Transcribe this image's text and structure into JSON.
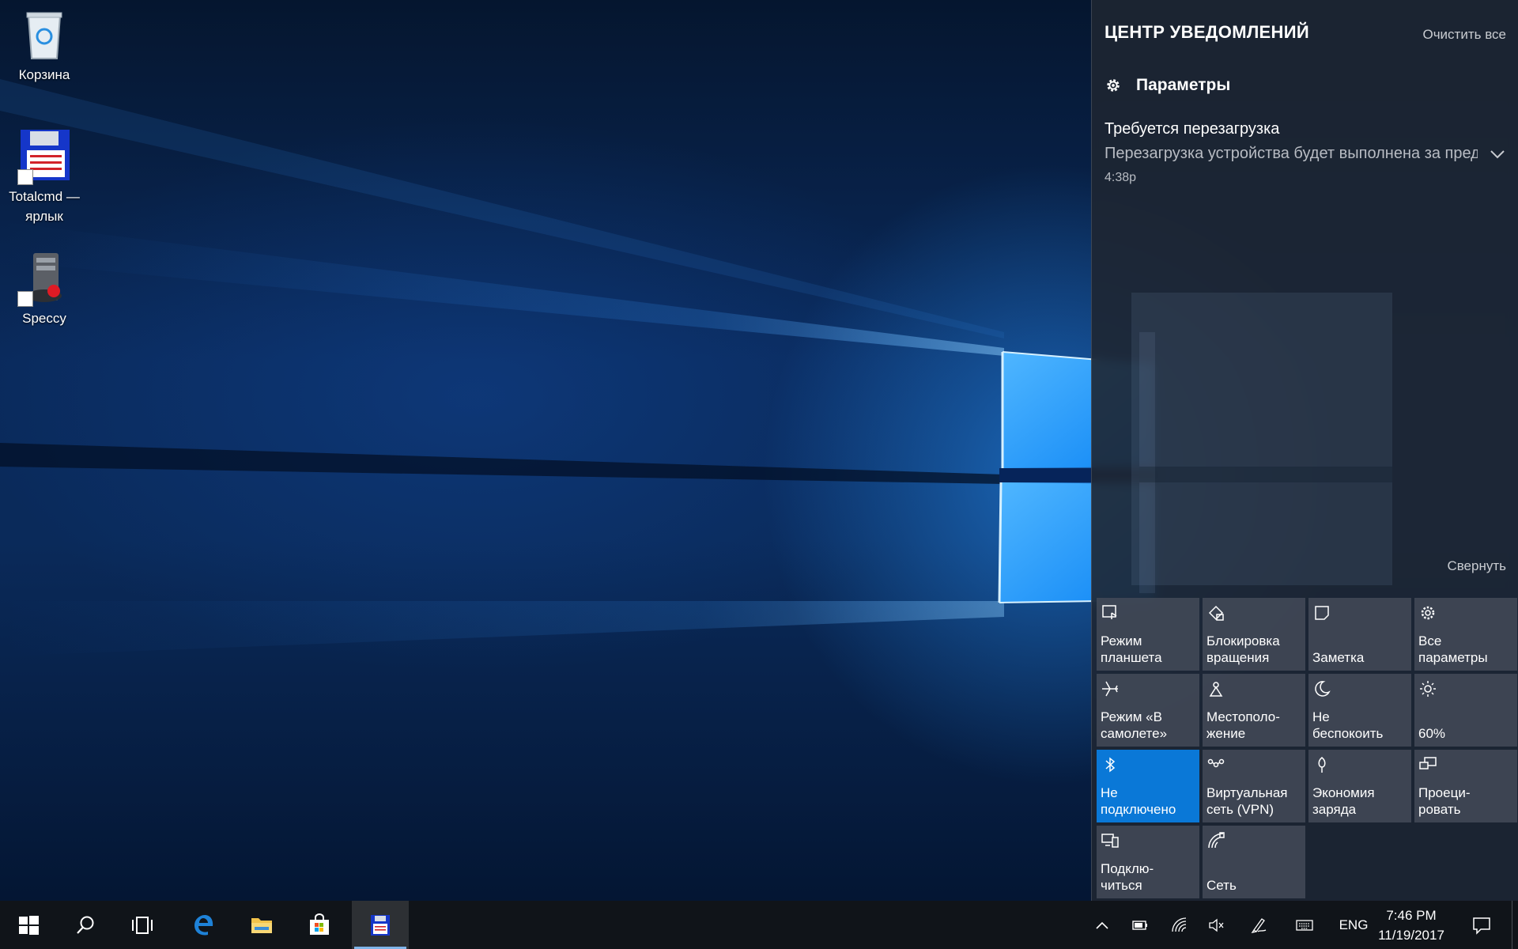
{
  "desktop": {
    "icons": [
      {
        "label": "Корзина",
        "icon": "recycle-bin-icon"
      },
      {
        "label": "Totalcmd — ярлык",
        "icon": "floppy-disk-icon"
      },
      {
        "label": "Speccy",
        "icon": "speccy-icon"
      }
    ]
  },
  "action_center": {
    "title": "ЦЕНТР УВЕДОМЛЕНИЙ",
    "clear_all": "Очистить все",
    "app_group": {
      "label": "Параметры",
      "icon": "gear-icon"
    },
    "notification": {
      "title": "Требуется перезагрузка",
      "body": "Перезагрузка устройства будет выполнена за пределами периода активности.",
      "time": "4:38р"
    },
    "collapse": "Свернуть",
    "quick_actions": [
      {
        "label": "Режим\nпланшета",
        "icon": "tablet-mode-icon",
        "active": false
      },
      {
        "label": "Блокировка\nвращения",
        "icon": "rotation-lock-icon",
        "active": false
      },
      {
        "label": "Заметка",
        "icon": "note-icon",
        "active": false
      },
      {
        "label": "Все\nпараметры",
        "icon": "settings-icon",
        "active": false
      },
      {
        "label": "Режим «В\nсамолете»",
        "icon": "airplane-icon",
        "active": false
      },
      {
        "label": "Местополо-\nжение",
        "icon": "location-icon",
        "active": false
      },
      {
        "label": "Не\nбеспокоить",
        "icon": "moon-icon",
        "active": false
      },
      {
        "label": "60%",
        "icon": "brightness-icon",
        "active": false
      },
      {
        "label": "Не\nподключено",
        "icon": "bluetooth-icon",
        "active": true
      },
      {
        "label": "Виртуальная\nсеть (VPN)",
        "icon": "vpn-icon",
        "active": false
      },
      {
        "label": "Экономия\nзаряда",
        "icon": "battery-saver-icon",
        "active": false
      },
      {
        "label": "Проеци-\nровать",
        "icon": "project-icon",
        "active": false
      },
      {
        "label": "Подклю-\nчиться",
        "icon": "connect-icon",
        "active": false
      },
      {
        "label": "Сеть",
        "icon": "network-icon",
        "active": false
      }
    ]
  },
  "taskbar": {
    "pinned": [
      {
        "name": "start",
        "icon": "windows-logo-icon"
      },
      {
        "name": "search",
        "icon": "search-icon"
      },
      {
        "name": "task-view",
        "icon": "task-view-icon"
      },
      {
        "name": "edge",
        "icon": "edge-icon"
      },
      {
        "name": "file-explorer",
        "icon": "folder-icon"
      },
      {
        "name": "store",
        "icon": "store-icon"
      },
      {
        "name": "total-commander",
        "icon": "floppy-disk-icon",
        "active": true
      }
    ],
    "tray": {
      "icons": [
        "chevron-up-icon",
        "battery-icon",
        "wifi-icon",
        "volume-muted-icon",
        "pen-icon",
        "keyboard-icon"
      ],
      "language": "ENG",
      "time": "7:46 PM",
      "date": "11/19/2017"
    }
  }
}
